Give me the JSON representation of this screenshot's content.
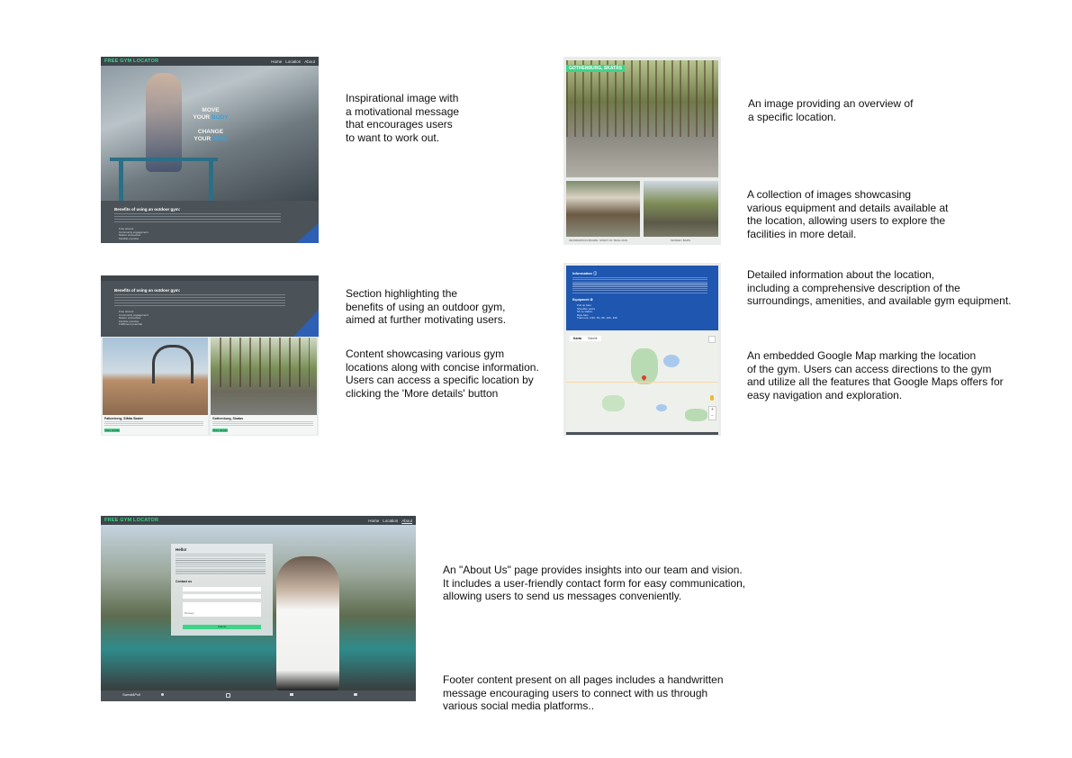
{
  "shots": {
    "home": {
      "brand": "FREE GYM LOCATOR",
      "nav": [
        "Home",
        "Location",
        "About"
      ],
      "hero": {
        "line1a": "MOVE",
        "line2a": "YOUR",
        "line2b": "BODY",
        "line3a": "CHANGE",
        "line4a": "YOUR",
        "line4b": "MIND"
      },
      "benefits_title": "Benefits of using an outdoor gym:",
      "list": [
        "Free access",
        "Community engagement",
        "Nature connection",
        "Flexible exercise"
      ]
    },
    "benefits": {
      "title": "Benefits of using an outdoor gym:",
      "list": [
        "Free access",
        "Community engagement",
        "Nature connection",
        "Flexible exercise",
        "Fulfillment potential"
      ],
      "cards": [
        {
          "title": "Falkenberg, Slåtta Skatet",
          "button": "More details"
        },
        {
          "title": "Gothenburg, Skatas",
          "button": "More details"
        }
      ]
    },
    "location": {
      "banner": "GOTHENBURG, SKATÅS",
      "thumb_captions": [
        "INFORMATION BOARD, START OF TRAIL RUN",
        "MONKEY BARS"
      ]
    },
    "details": {
      "info_title": "Information",
      "equipment_title": "Equipment",
      "equipment": [
        "Pull up bars",
        "Shoulder press",
        "Sit up station",
        "Dips bars",
        "Trail runs: 2,5K, 5K, 8K, 10K, 16K"
      ],
      "map_tabs": [
        "Karta",
        "Satellit"
      ]
    },
    "about": {
      "brand": "FREE GYM LOCATOR",
      "nav": [
        "Home",
        "Location",
        "About"
      ],
      "hello": "Hello!",
      "contact_title": "Contact us",
      "fields": [
        "Name",
        "Email",
        "Message"
      ],
      "submit": "Submit",
      "footer_signature": "Sweat$Poll"
    }
  },
  "captions": {
    "c1": "Inspirational image with\na motivational message\nthat encourages users\nto want to work out.",
    "c2": "Section highlighting the\nbenefits of using an outdoor gym,\naimed at further motivating users.",
    "c3": "Content showcasing various gym\nlocations along with concise information.\nUsers can access a specific location by\nclicking the 'More details' button",
    "c4": "An image providing an overview of\na specific location.",
    "c5": "A collection of images showcasing\nvarious equipment and details available at\nthe location, allowing users to explore the\nfacilities in more detail.",
    "c6": "Detailed information about the location,\nincluding a comprehensive description of the\nsurroundings, amenities, and available gym equipment.",
    "c7": "An embedded Google Map marking the location\nof the gym. Users can access directions to the gym\nand utilize all the features that Google Maps offers for\neasy navigation and exploration.",
    "c8": "An \"About Us\" page provides insights into our team and vision.\nIt includes a user-friendly contact form for easy communication,\n allowing users to send us messages conveniently.",
    "c9": "Footer content present on all pages includes a handwritten\nmessage encouraging users to connect with us through\nvarious social media platforms.."
  }
}
